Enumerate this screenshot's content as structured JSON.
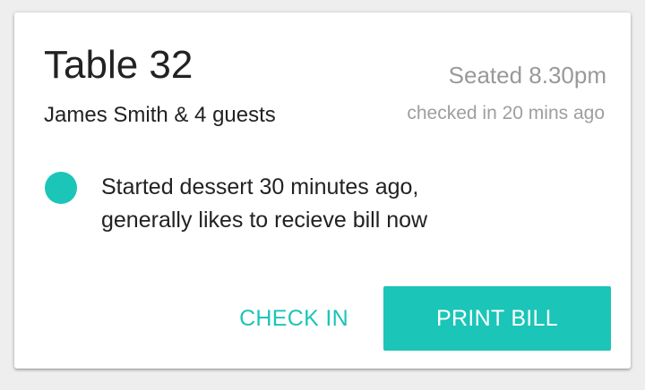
{
  "card": {
    "title": "Table 32",
    "guests": "James Smith & 4 guests",
    "seated": "Seated 8.30pm",
    "checked_in": "checked in 20 mins ago",
    "status_color": "#1bc5b8",
    "note_lines": [
      "Started dessert 30 minutes ago,",
      "generally likes to recieve bill now"
    ]
  },
  "actions": {
    "check_in_label": "CHECK IN",
    "print_bill_label": "PRINT BILL"
  },
  "colors": {
    "accent": "#1bc5b8",
    "background": "#eeeeee",
    "card": "#ffffff",
    "text_primary": "#222222",
    "text_secondary": "#999999"
  }
}
